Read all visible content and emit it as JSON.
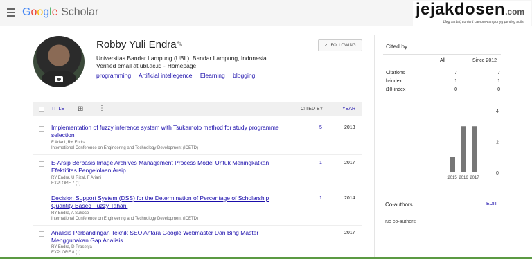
{
  "header": {
    "logo": {
      "g1": "G",
      "g2": "o",
      "g3": "o",
      "g4": "g",
      "g5": "l",
      "g6": "e",
      "scholar": " Scholar"
    }
  },
  "watermark": {
    "main": "jejakdosen",
    "suffix": ".com",
    "tagline": "blog santai, content campur-campur yg penting nulis"
  },
  "profile": {
    "name": "Robby Yuli Endra",
    "affiliation": "Universitas Bandar Lampung (UBL), Bandar Lampung, Indonesia",
    "email_text": "Verified email at ubl.ac.id -",
    "homepage": "Homepage",
    "interests": [
      "programming",
      "Artificial intellegence",
      "Elearning",
      "blogging"
    ],
    "follow_label": "FOLLOWING"
  },
  "table": {
    "col_title": "TITLE",
    "col_cited": "CITED BY",
    "col_year": "YEAR",
    "rows": [
      {
        "title": "Implementation of fuzzy inference system with Tsukamoto method for study programme selection",
        "authors": "F Ariani, RY Endra",
        "venue": "International Conference on Engineering and Technology Development (ICETD)",
        "cited": "5",
        "year": "2013"
      },
      {
        "title": "E-Arsip Berbasis Image Archives Management Process Model Untuk Meningkatkan Efektifitas Pengelolaan Arsip",
        "authors": "RY Endra, U Rizal, F Ariani",
        "venue": "EXPLORE 7 (1)",
        "cited": "1",
        "year": "2017"
      },
      {
        "title": "Decision Support System (DSS) for the Determination of Percentage of Scholarship Quantity Based Fuzzy Tahani",
        "authors": "RY Endra, A Sukoco",
        "venue": "International Conference on Engineering and Technology Development (ICETD)",
        "cited": "1",
        "year": "2014"
      },
      {
        "title": "Analisis Perbandingan Teknik SEO Antara Google Webmaster Dan Bing Master Menggunakan Gap Analisis",
        "authors": "RY Endra, D Prasetya",
        "venue": "EXPLORE 8 (1)",
        "cited": "",
        "year": "2017"
      }
    ]
  },
  "cited_by": {
    "title": "Cited by",
    "col_all": "All",
    "col_since": "Since 2012",
    "rows": [
      {
        "label": "Citations",
        "all": "7",
        "since": "7"
      },
      {
        "label": "h-index",
        "all": "1",
        "since": "1"
      },
      {
        "label": "i10-index",
        "all": "0",
        "since": "0"
      }
    ]
  },
  "chart_data": {
    "type": "bar",
    "categories": [
      "2015",
      "2016",
      "2017"
    ],
    "values": [
      1,
      3,
      3
    ],
    "ylim": [
      0,
      4
    ],
    "yticks": [
      "0",
      "2",
      "4"
    ],
    "bar_color": "#777777"
  },
  "coauthors": {
    "title": "Co-authors",
    "edit": "EDIT",
    "empty": "No co-authors"
  }
}
